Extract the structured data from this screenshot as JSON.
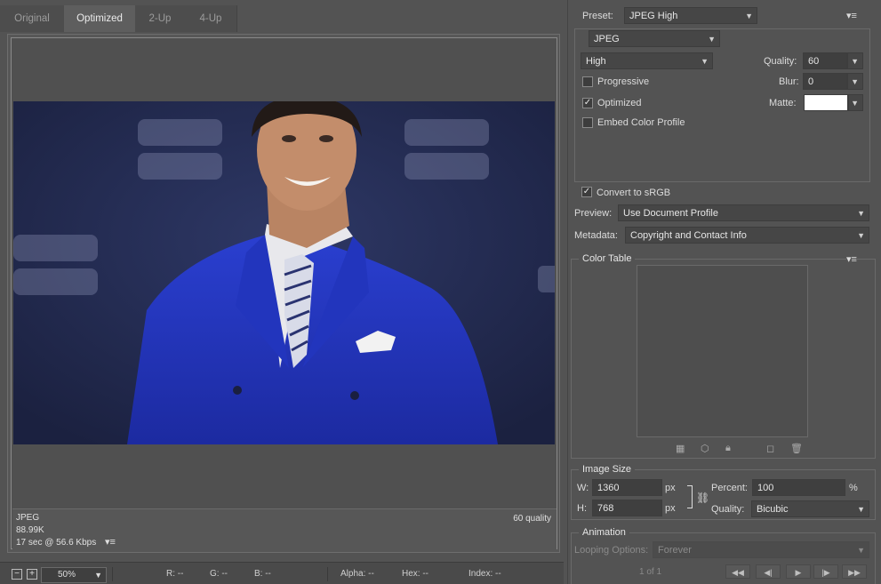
{
  "tabs": [
    {
      "label": "Original",
      "active": false
    },
    {
      "label": "Optimized",
      "active": true
    },
    {
      "label": "2-Up",
      "active": false
    },
    {
      "label": "4-Up",
      "active": false
    }
  ],
  "info": {
    "format": "JPEG",
    "size": "88.99K",
    "download": "17 sec @ 56.6 Kbps",
    "quality": "60 quality"
  },
  "bottombar": {
    "zoom": "50%",
    "r": "R: --",
    "g": "G: --",
    "b": "B: --",
    "alpha": "Alpha: --",
    "hex": "Hex: --",
    "index": "Index: --"
  },
  "settings": {
    "preset_label": "Preset:",
    "preset_value": "JPEG High",
    "format": "JPEG",
    "compression": "High",
    "quality_label": "Quality:",
    "quality_value": "60",
    "blur_label": "Blur:",
    "blur_value": "0",
    "matte_label": "Matte:",
    "progressive": "Progressive",
    "optimized": "Optimized",
    "embed_profile": "Embed Color Profile",
    "convert_srgb": "Convert to sRGB",
    "preview_label": "Preview:",
    "preview_value": "Use Document Profile",
    "metadata_label": "Metadata:",
    "metadata_value": "Copyright and Contact Info"
  },
  "color_table": {
    "title": "Color Table"
  },
  "image_size": {
    "title": "Image Size",
    "w_label": "W:",
    "w_value": "1360",
    "h_label": "H:",
    "h_value": "768",
    "unit": "px",
    "percent_label": "Percent:",
    "percent_value": "100",
    "percent_unit": "%",
    "quality_label": "Quality:",
    "quality_value": "Bicubic"
  },
  "animation": {
    "title": "Animation",
    "looping_label": "Looping Options:",
    "looping_value": "Forever",
    "frame": "1 of 1"
  }
}
